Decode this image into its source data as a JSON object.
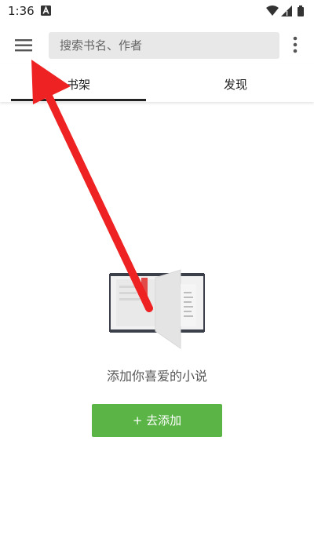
{
  "status_bar": {
    "time": "1:36"
  },
  "toolbar": {
    "search_placeholder": "搜索书名、作者"
  },
  "tabs": [
    {
      "label": "书架",
      "selected": true
    },
    {
      "label": "发现",
      "selected": false
    }
  ],
  "empty_state": {
    "message": "添加你喜爱的小说",
    "button_label": "+ 去添加"
  },
  "colors": {
    "accent_green": "#5ab446",
    "annotation_red": "#ee2222"
  },
  "icons": {
    "menu": "hamburger-menu-icon",
    "overflow": "more-vert-icon",
    "wifi": "wifi-icon",
    "signal": "signal-icon",
    "battery": "battery-icon"
  }
}
